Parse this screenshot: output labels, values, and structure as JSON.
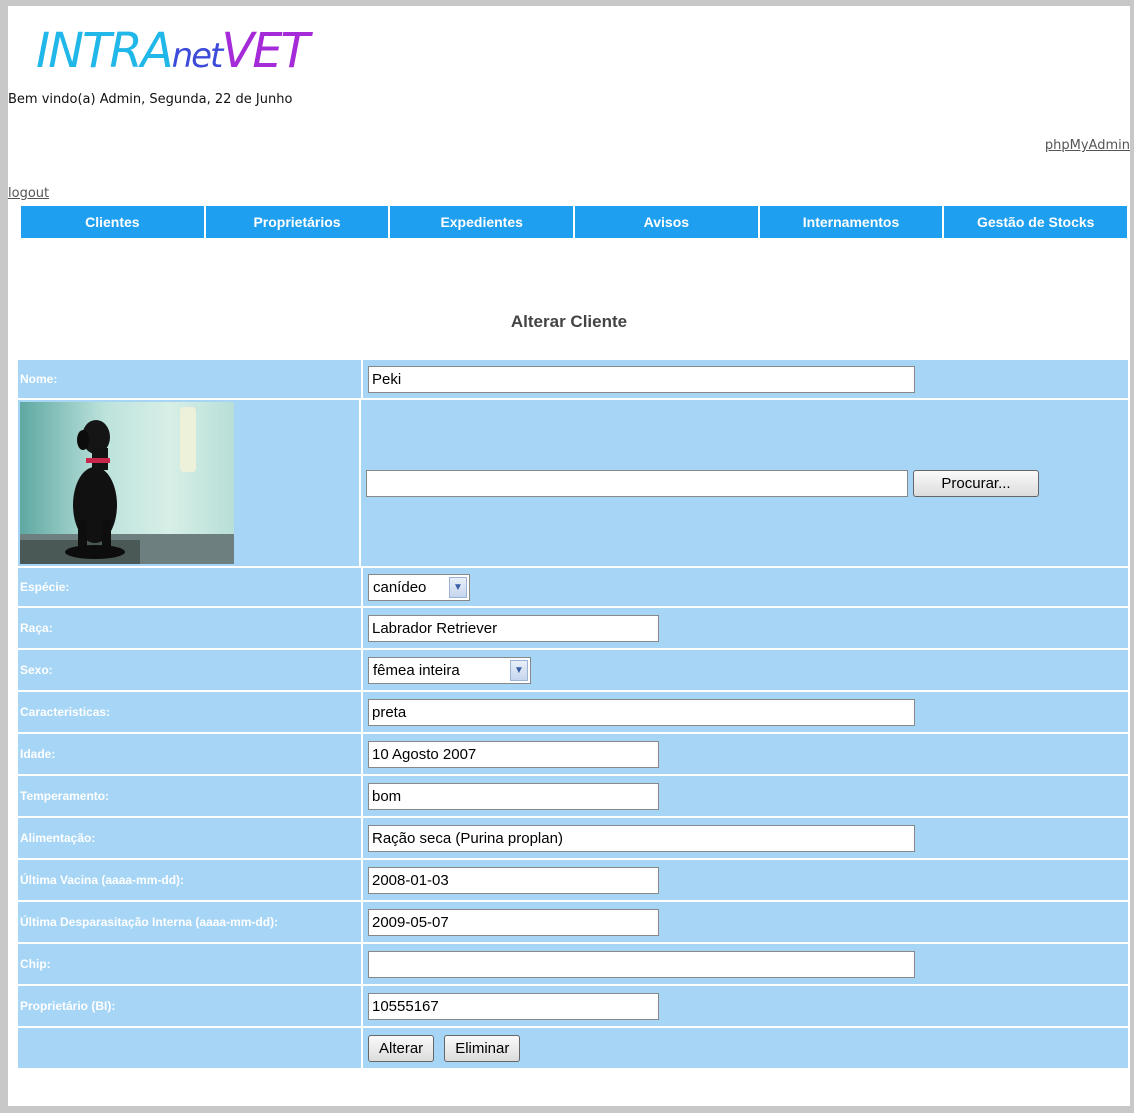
{
  "header": {
    "logo_a": "INTRA",
    "logo_b": "net",
    "logo_c": "VET",
    "welcome": "Bem vindo(a) Admin, Segunda, 22 de Junho",
    "phpmyadmin": "phpMyAdmin",
    "logout": "logout"
  },
  "nav": [
    "Clientes",
    "Proprietários",
    "Expedientes",
    "Avisos",
    "Internamentos",
    "Gestão de Stocks"
  ],
  "page_title": "Alterar Cliente",
  "form": {
    "nome_label": "Nome:",
    "nome_value": "Peki",
    "file_value": "",
    "browse_label": "Procurar...",
    "especie_label": "Espécie:",
    "especie_value": "canídeo",
    "raca_label": "Raça:",
    "raca_value": "Labrador Retriever",
    "sexo_label": "Sexo:",
    "sexo_value": "fêmea inteira",
    "caracteristicas_label": "Caracteristicas:",
    "caracteristicas_value": "preta",
    "idade_label": "Idade:",
    "idade_value": "10 Agosto 2007",
    "temperamento_label": "Temperamento:",
    "temperamento_value": "bom",
    "alimentacao_label": "Alimentação:",
    "alimentacao_value": "Ração seca (Purina proplan)",
    "vacina_label": "Última Vacina (aaaa-mm-dd):",
    "vacina_value": "2008-01-03",
    "desparasitacao_label": "Última Desparasitação Interna (aaaa-mm-dd):",
    "desparasitacao_value": "2009-05-07",
    "chip_label": "Chip:",
    "chip_value": "",
    "proprietario_label": "Proprietário (BI):",
    "proprietario_value": "10555167",
    "alterar_label": "Alterar",
    "eliminar_label": "Eliminar"
  },
  "colors": {
    "nav": "#1f9ff0",
    "form_bg": "#a6d5f6"
  }
}
